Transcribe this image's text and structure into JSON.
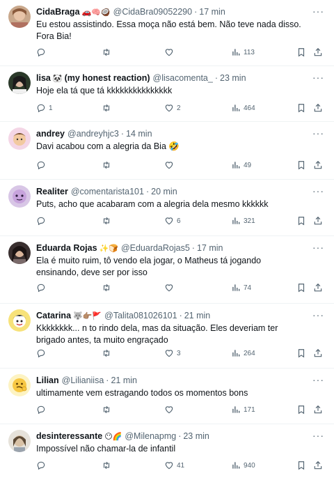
{
  "colors": {
    "text": "#0f1419",
    "muted": "#536471",
    "divider": "#eff3f4"
  },
  "tweets": [
    {
      "name": "CidaBraga",
      "emoji": "🚗🧠🥥",
      "handle": "@CidaBra09052290",
      "time": "17 min",
      "text": "Eu estou assistindo. Essa moça não está bem. Não teve nada disso. Fora Bia!",
      "replies": "",
      "retweets": "",
      "likes": "",
      "views": "113"
    },
    {
      "name": "lisa",
      "emoji": "🐼",
      "name_suffix": "(my honest reaction)",
      "handle": "@lisacomenta_",
      "time": "23 min",
      "text": "Hoje ela tá que tá kkkkkkkkkkkkkkk",
      "replies": "1",
      "retweets": "",
      "likes": "2",
      "views": "464"
    },
    {
      "name": "andrey",
      "emoji": "",
      "handle": "@andreyhjc3",
      "time": "14 min",
      "text": "Davi acabou com a alegria da Bia 🤣",
      "replies": "",
      "retweets": "",
      "likes": "",
      "views": "49"
    },
    {
      "name": "Realiter",
      "emoji": "",
      "handle": "@comentarista101",
      "time": "20 min",
      "text": "Puts, acho que acabaram com a alegria dela mesmo kkkkkk",
      "replies": "",
      "retweets": "",
      "likes": "6",
      "views": "321"
    },
    {
      "name": "Eduarda Rojas",
      "emoji": "✨🍞",
      "handle": "@EduardaRojas5",
      "time": "17 min",
      "text": "Ela é muito ruim, tô vendo ela jogar, o Matheus tá jogando ensinando, deve ser por isso",
      "replies": "",
      "retweets": "",
      "likes": "",
      "views": "74"
    },
    {
      "name": "Catarina",
      "emoji": "🐺👉🏽🚩",
      "handle": "@Talita081026101",
      "time": "21 min",
      "text": "Kkkkkkkk... n to rindo dela, mas da situação. Eles deveriam ter brigado antes, ta muito engraçado",
      "replies": "",
      "retweets": "",
      "likes": "3",
      "views": "264"
    },
    {
      "name": "Lilian",
      "emoji": "",
      "handle": "@Lilianiisa",
      "time": "21 min",
      "text": "ultimamente vem estragando todos os momentos bons",
      "replies": "",
      "retweets": "",
      "likes": "",
      "views": "171"
    },
    {
      "name": "desinteressante",
      "emoji": "😶🌈",
      "handle": "@Milenapmg",
      "time": "23 min",
      "text": "Impossível não chamar-la de infantil",
      "replies": "",
      "retweets": "",
      "likes": "41",
      "views": "940"
    }
  ]
}
